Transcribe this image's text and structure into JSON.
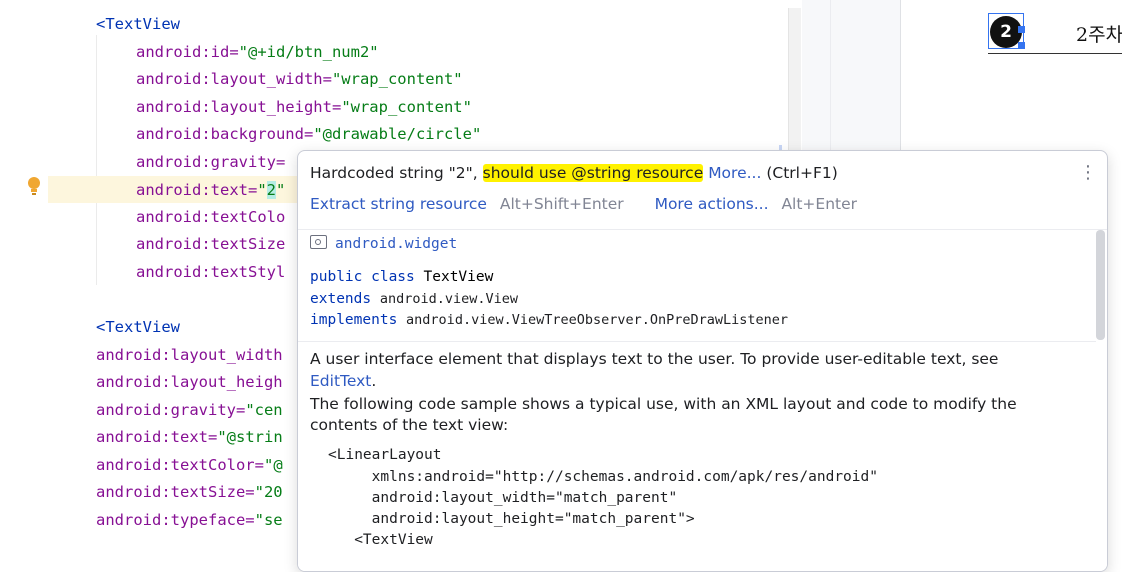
{
  "editor": {
    "lines": [
      {
        "parts": [
          {
            "c": "tag",
            "t": "<TextView"
          }
        ]
      },
      {
        "parts": [
          {
            "c": "attr",
            "t": "android:id="
          },
          {
            "c": "str",
            "t": "\"@+id/btn_num2\""
          }
        ]
      },
      {
        "parts": [
          {
            "c": "attr",
            "t": "android:layout_width="
          },
          {
            "c": "str",
            "t": "\"wrap_content\""
          }
        ]
      },
      {
        "parts": [
          {
            "c": "attr",
            "t": "android:layout_height="
          },
          {
            "c": "str",
            "t": "\"wrap_content\""
          }
        ]
      },
      {
        "parts": [
          {
            "c": "attr",
            "t": "android:background="
          },
          {
            "c": "str",
            "t": "\"@drawable/circle\""
          }
        ]
      },
      {
        "parts": [
          {
            "c": "attr",
            "t": "android:gravity="
          }
        ]
      },
      {
        "parts": [
          {
            "c": "attr",
            "t": "android:text="
          },
          {
            "c": "str",
            "t": "\""
          },
          {
            "c": "str caret-hl",
            "t": "2"
          },
          {
            "c": "str",
            "t": "\""
          }
        ]
      },
      {
        "parts": [
          {
            "c": "attr",
            "t": "android:textColo"
          }
        ]
      },
      {
        "parts": [
          {
            "c": "attr",
            "t": "android:textSize"
          }
        ]
      },
      {
        "parts": [
          {
            "c": "attr",
            "t": "android:textStyl"
          }
        ]
      },
      {
        "parts": []
      },
      {
        "parts": [
          {
            "c": "tag",
            "t": "<TextView"
          }
        ]
      },
      {
        "parts": [
          {
            "c": "attr",
            "t": "android:layout_width"
          }
        ]
      },
      {
        "parts": [
          {
            "c": "attr",
            "t": "android:layout_heigh"
          }
        ]
      },
      {
        "parts": [
          {
            "c": "attr",
            "t": "android:gravity="
          },
          {
            "c": "str",
            "t": "\"cen"
          }
        ]
      },
      {
        "parts": [
          {
            "c": "attr",
            "t": "android:text="
          },
          {
            "c": "str",
            "t": "\"@strin"
          }
        ]
      },
      {
        "parts": [
          {
            "c": "attr",
            "t": "android:textColor="
          },
          {
            "c": "str",
            "t": "\"@"
          }
        ]
      },
      {
        "parts": [
          {
            "c": "attr",
            "t": "android:textSize="
          },
          {
            "c": "str",
            "t": "\"20"
          }
        ]
      },
      {
        "parts": [
          {
            "c": "attr",
            "t": "android:typeface="
          },
          {
            "c": "str",
            "t": "\"se"
          }
        ]
      }
    ]
  },
  "preview": {
    "circle_text": "2",
    "label": "2주차"
  },
  "popup": {
    "msg_prefix": "Hardcoded string \"2\", ",
    "msg_highlight": "should use @string resource",
    "more_link": "More...",
    "more_shortcut": "(Ctrl+F1)",
    "action1": "Extract string resource",
    "action1_shortcut": "Alt+Shift+Enter",
    "action2": "More actions...",
    "action2_shortcut": "Alt+Enter",
    "package": "android.widget",
    "sig_public": "public class",
    "sig_class": "TextView",
    "sig_extends": "extends",
    "sig_extends_cls": "android.view.View",
    "sig_implements": "implements",
    "sig_implements_cls": "android.view.ViewTreeObserver.OnPreDrawListener",
    "desc1": "A user interface element that displays text to the user. To provide user-editable text, see",
    "desc1_link": "EditText",
    "desc1_end": ".",
    "desc2": "The following code sample shows a typical use, with an XML layout and code to modify the",
    "desc3": "contents of the text view:",
    "code_lines": [
      "<LinearLayout",
      "     xmlns:android=\"http://schemas.android.com/apk/res/android\"",
      "     android:layout_width=\"match_parent\"",
      "     android:layout_height=\"match_parent\">",
      "   <TextView"
    ]
  }
}
